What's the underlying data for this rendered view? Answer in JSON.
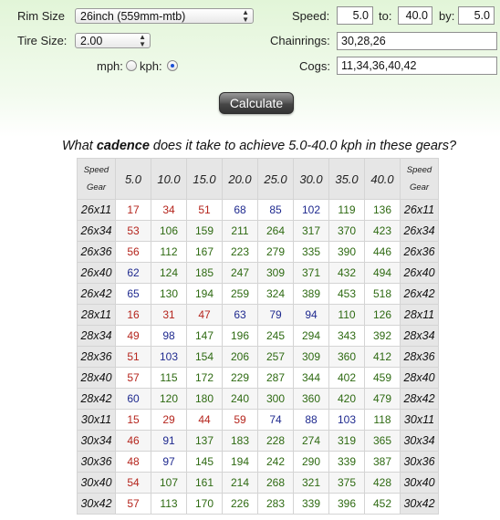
{
  "form": {
    "rim_size_label": "Rim Size",
    "rim_size_value": "26inch (559mm-mtb)",
    "tire_size_label": "Tire Size:",
    "tire_size_value": "2.00",
    "units_mph_label": "mph:",
    "units_kph_label": "kph:",
    "units_selected": "kph",
    "speed_label": "Speed:",
    "speed_from": "5.0",
    "to_label": "to:",
    "speed_to": "40.0",
    "by_label": "by:",
    "speed_by": "5.0",
    "chainrings_label": "Chainrings:",
    "chainrings_value": "30,28,26",
    "cogs_label": "Cogs:",
    "cogs_value": "11,34,36,40,42",
    "calculate_label": "Calculate"
  },
  "question": {
    "prefix": "What ",
    "emphasis": "cadence",
    "suffix": " does it take to achieve 5.0-40.0 kph in these gears?"
  },
  "table": {
    "corner_top": "Speed",
    "corner_bottom": "Gear",
    "speeds": [
      "5.0",
      "10.0",
      "15.0",
      "20.0",
      "25.0",
      "30.0",
      "35.0",
      "40.0"
    ],
    "colors": {
      "low": "#b5251d",
      "mid": "#1f2a8f",
      "high": "#2e6a12"
    },
    "rows": [
      {
        "gear": "26x11",
        "values": [
          17,
          34,
          51,
          68,
          85,
          102,
          119,
          136
        ]
      },
      {
        "gear": "26x34",
        "values": [
          53,
          106,
          159,
          211,
          264,
          317,
          370,
          423
        ]
      },
      {
        "gear": "26x36",
        "values": [
          56,
          112,
          167,
          223,
          279,
          335,
          390,
          446
        ]
      },
      {
        "gear": "26x40",
        "values": [
          62,
          124,
          185,
          247,
          309,
          371,
          432,
          494
        ]
      },
      {
        "gear": "26x42",
        "values": [
          65,
          130,
          194,
          259,
          324,
          389,
          453,
          518
        ]
      },
      {
        "gear": "28x11",
        "values": [
          16,
          31,
          47,
          63,
          79,
          94,
          110,
          126
        ]
      },
      {
        "gear": "28x34",
        "values": [
          49,
          98,
          147,
          196,
          245,
          294,
          343,
          392
        ]
      },
      {
        "gear": "28x36",
        "values": [
          51,
          103,
          154,
          206,
          257,
          309,
          360,
          412
        ]
      },
      {
        "gear": "28x40",
        "values": [
          57,
          115,
          172,
          229,
          287,
          344,
          402,
          459
        ]
      },
      {
        "gear": "28x42",
        "values": [
          60,
          120,
          180,
          240,
          300,
          360,
          420,
          479
        ]
      },
      {
        "gear": "30x11",
        "values": [
          15,
          29,
          44,
          59,
          74,
          88,
          103,
          118
        ]
      },
      {
        "gear": "30x34",
        "values": [
          46,
          91,
          137,
          183,
          228,
          274,
          319,
          365
        ]
      },
      {
        "gear": "30x36",
        "values": [
          48,
          97,
          145,
          194,
          242,
          290,
          339,
          387
        ]
      },
      {
        "gear": "30x40",
        "values": [
          54,
          107,
          161,
          214,
          268,
          321,
          375,
          428
        ]
      },
      {
        "gear": "30x42",
        "values": [
          57,
          113,
          170,
          226,
          283,
          339,
          396,
          452
        ]
      }
    ]
  }
}
